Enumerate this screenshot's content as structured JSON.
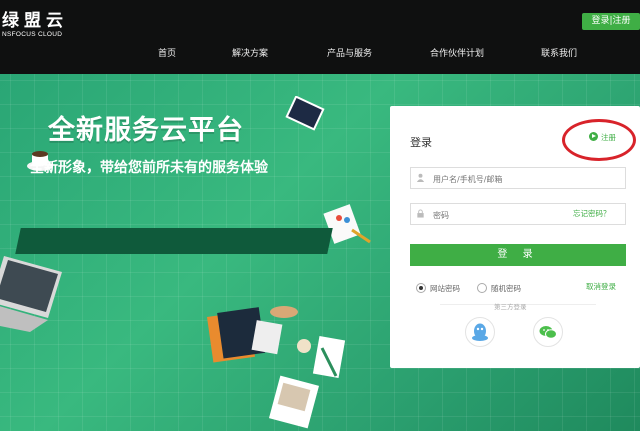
{
  "brand": {
    "name_cn": "绿盟云",
    "name_en": "NSFOCUS CLOUD"
  },
  "header": {
    "login_register": "登录|注册",
    "nav": [
      "首页",
      "解决方案",
      "产品与服务",
      "合作伙伴计划",
      "联系我们"
    ]
  },
  "hero": {
    "headline": "全新服务云平台",
    "tagline": "全新形象，带给您前所未有的服务体验"
  },
  "login": {
    "title": "登录",
    "register_link": "注册",
    "username_placeholder": "用户名/手机号/邮箱",
    "password_placeholder": "密码",
    "forgot": "忘记密码？",
    "submit": "登 录",
    "options": [
      {
        "label": "网站密码",
        "selected": true
      },
      {
        "label": "随机密码",
        "selected": false
      }
    ],
    "cancel": "取消登录",
    "third_party": "第三方登录",
    "social": [
      "qq-icon",
      "wechat-icon"
    ]
  },
  "colors": {
    "accent": "#3fae45",
    "annotation": "#d8232a",
    "topbar": "#0f1010"
  }
}
